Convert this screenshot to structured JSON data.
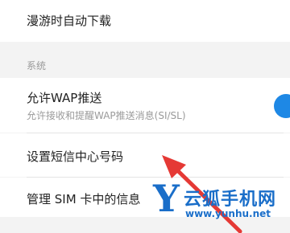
{
  "settings": {
    "top_item": "漫游时自动下载",
    "section_label": "系统",
    "wap_push": {
      "title": "允许WAP推送",
      "subtitle": "允许接收和提醒WAP推送消息(SI/SL)",
      "enabled": true
    },
    "sms_center": "设置短信中心号码",
    "sim_messages": "管理 SIM 卡中的信息"
  },
  "watermark": {
    "letter": "Y",
    "name": "云狐手机网",
    "url": "www.yunhu.net"
  },
  "colors": {
    "accent": "#1e88e5",
    "arrow": "#e53935",
    "watermark": "#1a6ec9"
  }
}
